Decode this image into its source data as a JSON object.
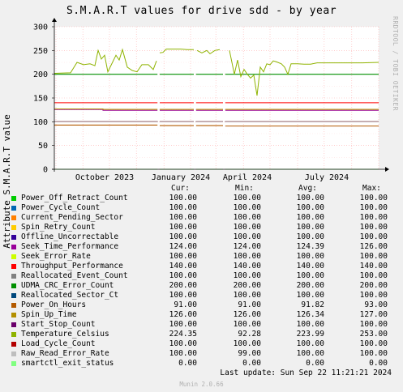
{
  "chart_data": {
    "type": "line",
    "title": "S.M.A.R.T values for drive sdd - by year",
    "ylabel": "Attribute S.M.A.R.T value",
    "ylim": [
      0,
      300
    ],
    "yticks": [
      0,
      50,
      100,
      150,
      200,
      250,
      300
    ],
    "xticks": [
      "October 2023",
      "January 2024",
      "April 2024",
      "July 2024"
    ],
    "grid": true,
    "series": [
      {
        "name": "Power_Off_Retract_Count",
        "color": "#00cc00",
        "level": 100
      },
      {
        "name": "Power_Cycle_Count",
        "color": "#0066b3",
        "level": 100
      },
      {
        "name": "Current_Pending_Sector",
        "color": "#ff8000",
        "level": 100
      },
      {
        "name": "Spin_Retry_Count",
        "color": "#ffcc00",
        "level": 100
      },
      {
        "name": "Offline_Uncorrectable",
        "color": "#330099",
        "level": 100
      },
      {
        "name": "Seek_Time_Performance",
        "color": "#990099",
        "level": 124
      },
      {
        "name": "Seek_Error_Rate",
        "color": "#ccff00",
        "level": 100
      },
      {
        "name": "Throughput_Performance",
        "color": "#ff0000",
        "level": 140
      },
      {
        "name": "Reallocated_Event_Count",
        "color": "#808080",
        "level": 100
      },
      {
        "name": "UDMA_CRC_Error_Count",
        "color": "#008f00",
        "level": 200
      },
      {
        "name": "Reallocated_Sector_Ct",
        "color": "#00487d",
        "level": 100
      },
      {
        "name": "Power_On_Hours",
        "color": "#b35a00",
        "level": 91
      },
      {
        "name": "Spin_Up_Time",
        "color": "#b38f00",
        "level": 126
      },
      {
        "name": "Start_Stop_Count",
        "color": "#6b006b",
        "level": 100
      },
      {
        "name": "Temperature_Celsius",
        "color": "#8fb300",
        "level": 224
      },
      {
        "name": "Load_Cycle_Count",
        "color": "#b30000",
        "level": 100
      },
      {
        "name": "Raw_Read_Error_Rate",
        "color": "#bebebe",
        "level": 100
      },
      {
        "name": "smartctl_exit_status",
        "color": "#80ff80",
        "level": 0
      }
    ],
    "temperature_profile": [
      [
        0.0,
        202
      ],
      [
        0.05,
        203
      ],
      [
        0.07,
        225
      ],
      [
        0.09,
        220
      ],
      [
        0.11,
        222
      ],
      [
        0.125,
        218
      ],
      [
        0.135,
        250
      ],
      [
        0.145,
        232
      ],
      [
        0.155,
        240
      ],
      [
        0.165,
        205
      ],
      [
        0.17,
        212
      ],
      [
        0.19,
        240
      ],
      [
        0.2,
        230
      ],
      [
        0.21,
        252
      ],
      [
        0.225,
        215
      ],
      [
        0.24,
        208
      ],
      [
        0.255,
        205
      ],
      [
        0.27,
        220
      ],
      [
        0.29,
        220
      ],
      [
        0.305,
        210
      ],
      [
        0.315,
        228
      ],
      [
        0.325,
        245
      ],
      [
        0.335,
        246
      ],
      [
        0.345,
        253
      ],
      [
        0.37,
        253
      ],
      [
        0.39,
        253
      ],
      [
        0.41,
        252
      ],
      [
        0.43,
        252
      ],
      [
        0.44,
        250
      ],
      [
        0.455,
        245
      ],
      [
        0.47,
        250
      ],
      [
        0.48,
        243
      ],
      [
        0.495,
        250
      ],
      [
        0.51,
        252
      ],
      [
        0.525,
        248
      ],
      [
        0.54,
        250
      ],
      [
        0.555,
        200
      ],
      [
        0.565,
        230
      ],
      [
        0.575,
        195
      ],
      [
        0.585,
        210
      ],
      [
        0.595,
        200
      ],
      [
        0.605,
        192
      ],
      [
        0.615,
        198
      ],
      [
        0.625,
        155
      ],
      [
        0.635,
        215
      ],
      [
        0.645,
        205
      ],
      [
        0.655,
        222
      ],
      [
        0.665,
        220
      ],
      [
        0.675,
        228
      ],
      [
        0.685,
        226
      ],
      [
        0.7,
        222
      ],
      [
        0.71,
        215
      ],
      [
        0.72,
        200
      ],
      [
        0.73,
        222
      ],
      [
        0.75,
        222
      ],
      [
        0.77,
        221
      ],
      [
        0.79,
        221
      ],
      [
        0.81,
        224
      ],
      [
        0.85,
        224
      ],
      [
        0.9,
        224
      ],
      [
        0.95,
        224
      ],
      [
        1.0,
        225
      ]
    ],
    "gaps": [
      [
        0.318,
        0.325
      ],
      [
        0.43,
        0.437
      ],
      [
        0.52,
        0.527
      ]
    ]
  },
  "legend": {
    "headers": {
      "cur": "Cur:",
      "min": "Min:",
      "avg": "Avg:",
      "max": "Max:"
    },
    "rows": [
      {
        "label": "Power_Off_Retract_Count",
        "cur": "100.00",
        "min": "100.00",
        "avg": "100.00",
        "max": "100.00"
      },
      {
        "label": "Power_Cycle_Count",
        "cur": "100.00",
        "min": "100.00",
        "avg": "100.00",
        "max": "100.00"
      },
      {
        "label": "Current_Pending_Sector",
        "cur": "100.00",
        "min": "100.00",
        "avg": "100.00",
        "max": "100.00"
      },
      {
        "label": "Spin_Retry_Count",
        "cur": "100.00",
        "min": "100.00",
        "avg": "100.00",
        "max": "100.00"
      },
      {
        "label": "Offline_Uncorrectable",
        "cur": "100.00",
        "min": "100.00",
        "avg": "100.00",
        "max": "100.00"
      },
      {
        "label": "Seek_Time_Performance",
        "cur": "124.00",
        "min": "124.00",
        "avg": "124.39",
        "max": "126.00"
      },
      {
        "label": "Seek_Error_Rate",
        "cur": "100.00",
        "min": "100.00",
        "avg": "100.00",
        "max": "100.00"
      },
      {
        "label": "Throughput_Performance",
        "cur": "140.00",
        "min": "140.00",
        "avg": "140.00",
        "max": "140.00"
      },
      {
        "label": "Reallocated_Event_Count",
        "cur": "100.00",
        "min": "100.00",
        "avg": "100.00",
        "max": "100.00"
      },
      {
        "label": "UDMA_CRC_Error_Count",
        "cur": "200.00",
        "min": "200.00",
        "avg": "200.00",
        "max": "200.00"
      },
      {
        "label": "Reallocated_Sector_Ct",
        "cur": "100.00",
        "min": "100.00",
        "avg": "100.00",
        "max": "100.00"
      },
      {
        "label": "Power_On_Hours",
        "cur": "91.00",
        "min": "91.00",
        "avg": "91.82",
        "max": "93.00"
      },
      {
        "label": "Spin_Up_Time",
        "cur": "126.00",
        "min": "126.00",
        "avg": "126.34",
        "max": "127.00"
      },
      {
        "label": "Start_Stop_Count",
        "cur": "100.00",
        "min": "100.00",
        "avg": "100.00",
        "max": "100.00"
      },
      {
        "label": "Temperature_Celsius",
        "cur": "224.35",
        "min": "92.28",
        "avg": "223.99",
        "max": "253.00"
      },
      {
        "label": "Load_Cycle_Count",
        "cur": "100.00",
        "min": "100.00",
        "avg": "100.00",
        "max": "100.00"
      },
      {
        "label": "Raw_Read_Error_Rate",
        "cur": "100.00",
        "min": "99.00",
        "avg": "100.00",
        "max": "100.00"
      },
      {
        "label": "smartctl_exit_status",
        "cur": "0.00",
        "min": "0.00",
        "avg": "0.00",
        "max": "0.00"
      }
    ]
  },
  "side_label": "RRDTOOL / TOBI OETIKER",
  "last_update": "Last update: Sun Sep 22 11:21:21 2024",
  "footer": "Munin 2.0.66"
}
